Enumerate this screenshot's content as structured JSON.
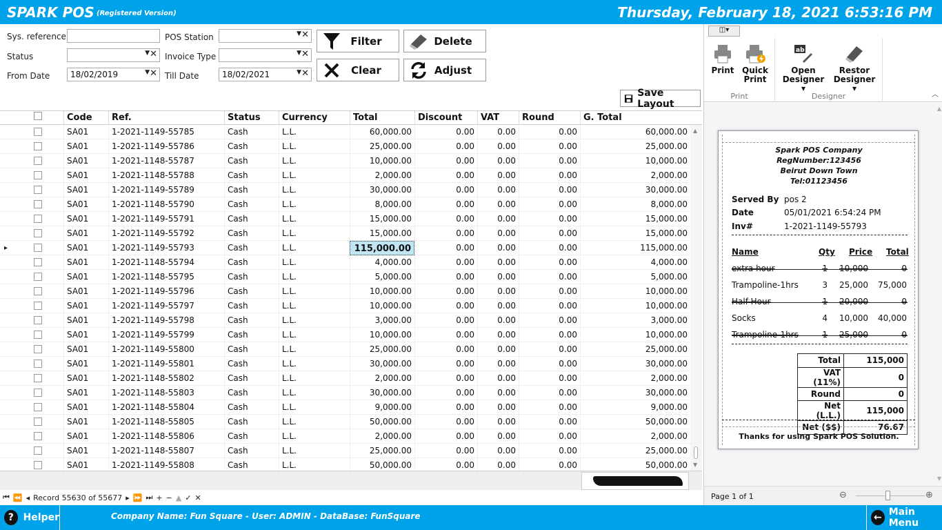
{
  "header": {
    "app_title": "SPARK POS",
    "app_subtitle": "(Registered Version)",
    "datetime": "Thursday, February 18, 2021 6:53:16 PM"
  },
  "filters": {
    "sys_reference_label": "Sys. reference",
    "sys_reference_value": "",
    "status_label": "Status",
    "status_value": "",
    "from_date_label": "From Date",
    "from_date_value": "18/02/2019",
    "pos_station_label": "POS Station",
    "pos_station_value": "",
    "invoice_type_label": "Invoice Type",
    "invoice_type_value": "",
    "till_date_label": "Till Date",
    "till_date_value": "18/02/2021"
  },
  "buttons": {
    "filter": "Filter",
    "delete": "Delete",
    "clear": "Clear",
    "adjust": "Adjust",
    "save_layout": "Save Layout"
  },
  "grid": {
    "columns": [
      "Code",
      "Ref.",
      "Status",
      "Currency",
      "Total",
      "Discount",
      "VAT",
      "Round",
      "G. Total"
    ],
    "rows": [
      [
        "SA01",
        "1-2021-1149-55785",
        "Cash",
        "L.L.",
        "60,000.00",
        "0.00",
        "0.00",
        "0.00",
        "60,000.00"
      ],
      [
        "SA01",
        "1-2021-1149-55786",
        "Cash",
        "L.L.",
        "25,000.00",
        "0.00",
        "0.00",
        "0.00",
        "25,000.00"
      ],
      [
        "SA01",
        "1-2021-1148-55787",
        "Cash",
        "L.L.",
        "10,000.00",
        "0.00",
        "0.00",
        "0.00",
        "10,000.00"
      ],
      [
        "SA01",
        "1-2021-1148-55788",
        "Cash",
        "L.L.",
        "2,000.00",
        "0.00",
        "0.00",
        "0.00",
        "2,000.00"
      ],
      [
        "SA01",
        "1-2021-1149-55789",
        "Cash",
        "L.L.",
        "30,000.00",
        "0.00",
        "0.00",
        "0.00",
        "30,000.00"
      ],
      [
        "SA01",
        "1-2021-1148-55790",
        "Cash",
        "L.L.",
        "8,000.00",
        "0.00",
        "0.00",
        "0.00",
        "8,000.00"
      ],
      [
        "SA01",
        "1-2021-1149-55791",
        "Cash",
        "L.L.",
        "15,000.00",
        "0.00",
        "0.00",
        "0.00",
        "15,000.00"
      ],
      [
        "SA01",
        "1-2021-1149-55792",
        "Cash",
        "L.L.",
        "15,000.00",
        "0.00",
        "0.00",
        "0.00",
        "15,000.00"
      ],
      [
        "SA01",
        "1-2021-1149-55793",
        "Cash",
        "L.L.",
        "115,000.00",
        "0.00",
        "0.00",
        "0.00",
        "115,000.00"
      ],
      [
        "SA01",
        "1-2021-1148-55794",
        "Cash",
        "L.L.",
        "4,000.00",
        "0.00",
        "0.00",
        "0.00",
        "4,000.00"
      ],
      [
        "SA01",
        "1-2021-1148-55795",
        "Cash",
        "L.L.",
        "5,000.00",
        "0.00",
        "0.00",
        "0.00",
        "5,000.00"
      ],
      [
        "SA01",
        "1-2021-1149-55796",
        "Cash",
        "L.L.",
        "10,000.00",
        "0.00",
        "0.00",
        "0.00",
        "10,000.00"
      ],
      [
        "SA01",
        "1-2021-1149-55797",
        "Cash",
        "L.L.",
        "10,000.00",
        "0.00",
        "0.00",
        "0.00",
        "10,000.00"
      ],
      [
        "SA01",
        "1-2021-1149-55798",
        "Cash",
        "L.L.",
        "3,000.00",
        "0.00",
        "0.00",
        "0.00",
        "3,000.00"
      ],
      [
        "SA01",
        "1-2021-1149-55799",
        "Cash",
        "L.L.",
        "10,000.00",
        "0.00",
        "0.00",
        "0.00",
        "10,000.00"
      ],
      [
        "SA01",
        "1-2021-1149-55800",
        "Cash",
        "L.L.",
        "25,000.00",
        "0.00",
        "0.00",
        "0.00",
        "25,000.00"
      ],
      [
        "SA01",
        "1-2021-1149-55801",
        "Cash",
        "L.L.",
        "30,000.00",
        "0.00",
        "0.00",
        "0.00",
        "30,000.00"
      ],
      [
        "SA01",
        "1-2021-1148-55802",
        "Cash",
        "L.L.",
        "2,000.00",
        "0.00",
        "0.00",
        "0.00",
        "2,000.00"
      ],
      [
        "SA01",
        "1-2021-1148-55803",
        "Cash",
        "L.L.",
        "30,000.00",
        "0.00",
        "0.00",
        "0.00",
        "30,000.00"
      ],
      [
        "SA01",
        "1-2021-1148-55804",
        "Cash",
        "L.L.",
        "9,000.00",
        "0.00",
        "0.00",
        "0.00",
        "9,000.00"
      ],
      [
        "SA01",
        "1-2021-1148-55805",
        "Cash",
        "L.L.",
        "50,000.00",
        "0.00",
        "0.00",
        "0.00",
        "50,000.00"
      ],
      [
        "SA01",
        "1-2021-1148-55806",
        "Cash",
        "L.L.",
        "2,000.00",
        "0.00",
        "0.00",
        "0.00",
        "2,000.00"
      ],
      [
        "SA01",
        "1-2021-1148-55807",
        "Cash",
        "L.L.",
        "25,000.00",
        "0.00",
        "0.00",
        "0.00",
        "25,000.00"
      ],
      [
        "SA01",
        "1-2021-1149-55808",
        "Cash",
        "L.L.",
        "50,000.00",
        "0.00",
        "0.00",
        "0.00",
        "50,000.00"
      ]
    ],
    "record_text": "Record 55630 of 55677"
  },
  "ribbon": {
    "print": "Print",
    "quick_print_1": "Quick",
    "quick_print_2": "Print",
    "open_designer_1": "Open",
    "open_designer_2": "Designer",
    "restor_designer_1": "Restor",
    "restor_designer_2": "Designer",
    "group_print": "Print",
    "group_designer": "Designer"
  },
  "receipt": {
    "company": "Spark POS Company",
    "reg": "RegNumber:123456",
    "address": "Beirut Down Town",
    "tel": "Tel:01123456",
    "served_by_label": "Served By",
    "served_by": "pos 2",
    "date_label": "Date",
    "date": "05/01/2021 6:54:24 PM",
    "inv_label": "Inv#",
    "inv": "1-2021-1149-55793",
    "col_name": "Name",
    "col_qty": "Qty",
    "col_price": "Price",
    "col_total": "Total",
    "items": [
      {
        "name": "extra hour",
        "qty": "1",
        "price": "10,000",
        "total": "0",
        "struck": true
      },
      {
        "name": "Trampoline-1hrs",
        "qty": "3",
        "price": "25,000",
        "total": "75,000",
        "struck": false
      },
      {
        "name": "Half-Hour",
        "qty": "1",
        "price": "20,000",
        "total": "0",
        "struck": true
      },
      {
        "name": "Socks",
        "qty": "4",
        "price": "10,000",
        "total": "40,000",
        "struck": false
      },
      {
        "name": "Trampoline-1hrs",
        "qty": "1",
        "price": "25,000",
        "total": "0",
        "struck": true
      }
    ],
    "totals": [
      [
        "Total",
        "115,000"
      ],
      [
        "VAT (11%)",
        "0"
      ],
      [
        "Round",
        "0"
      ],
      [
        "Net (L.L.)",
        "115,000"
      ],
      [
        "Net ($$)",
        "76.67"
      ]
    ],
    "thanks": "Thanks for using Spark POS Solution."
  },
  "preview_status": {
    "page": "Page 1 of 1"
  },
  "footer": {
    "helper": "Helper",
    "company_line": "Company Name: Fun Square - User: ADMIN - DataBase: FunSquare",
    "main_menu": "Main Menu"
  }
}
